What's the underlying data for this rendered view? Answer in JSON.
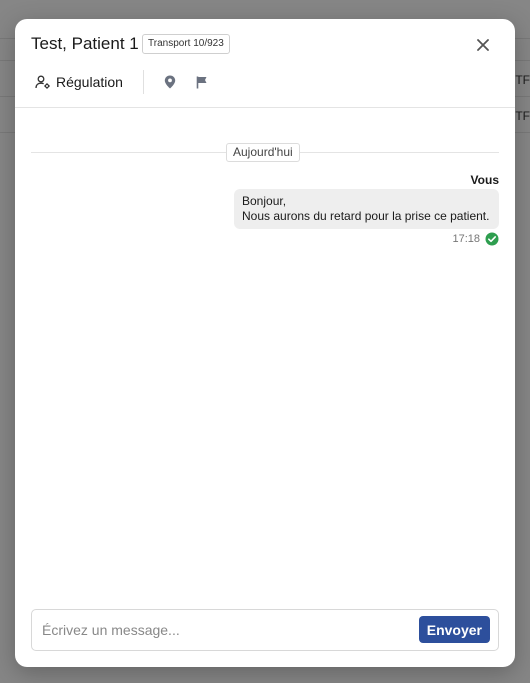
{
  "background": {
    "column_fragment_1": "NTF",
    "column_fragment_2": "NTF"
  },
  "modal": {
    "title": "Test, Patient 1",
    "badge": "Transport 10/923",
    "close_icon": "close-icon",
    "tabs": [
      {
        "label": "Régulation",
        "icon": "user-settings-icon"
      },
      {
        "icon": "location-pin-icon"
      },
      {
        "icon": "flag-icon"
      }
    ]
  },
  "chat": {
    "day_label": "Aujourd'hui",
    "messages": [
      {
        "sender": "Vous",
        "lines": [
          "Bonjour,",
          "Nous aurons du retard pour la prise ce patient."
        ],
        "time": "17:18",
        "status_icon": "check-circle-icon"
      }
    ]
  },
  "composer": {
    "placeholder": "Écrivez un message...",
    "value": "",
    "send_label": "Envoyer"
  },
  "colors": {
    "primary_button": "#2d4f9c",
    "read_status": "#2e9e4f",
    "bubble": "#eeeeee"
  }
}
